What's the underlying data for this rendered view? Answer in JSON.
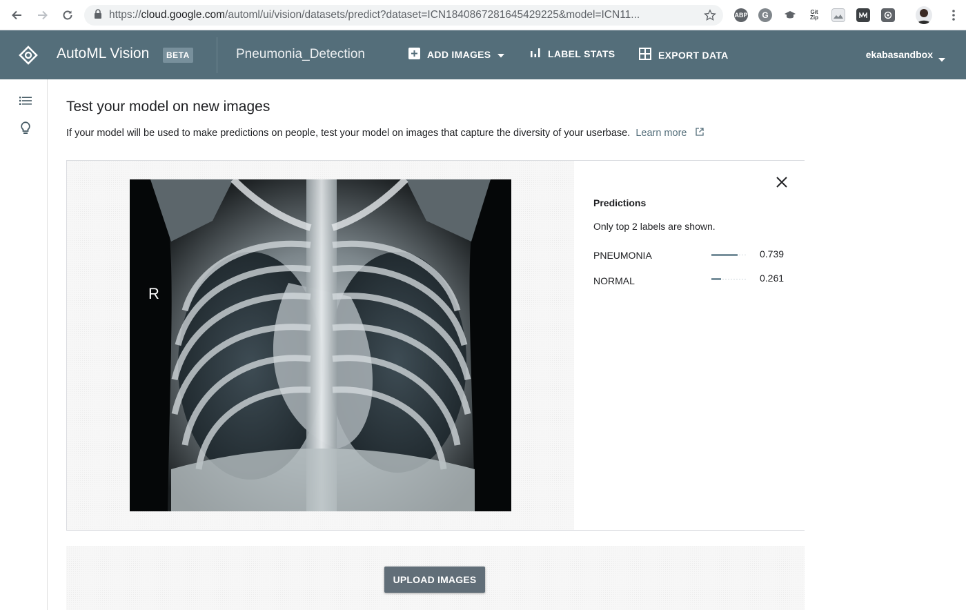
{
  "browser": {
    "url_scheme": "https://",
    "url_host": "cloud.google.com",
    "url_path": "/automl/ui/vision/datasets/predict?dataset=ICN1840867281645429225&model=ICN11...",
    "extensions": [
      "ABP",
      "G",
      "Git Zip"
    ]
  },
  "header": {
    "app_title": "AutoML Vision",
    "beta_label": "BETA",
    "dataset_name": "Pneumonia_Detection",
    "add_images_label": "ADD IMAGES",
    "label_stats_label": "LABEL STATS",
    "export_data_label": "EXPORT DATA",
    "account_name": "ekabasandbox"
  },
  "main": {
    "title": "Test your model on new images",
    "description": "If your model will be used to make predictions on people, test your model on images that capture the diversity of your userbase.",
    "learn_more_label": "Learn more",
    "image_marker": "R",
    "upload_button_label": "UPLOAD IMAGES"
  },
  "predictions": {
    "title": "Predictions",
    "note": "Only top 2 labels are shown.",
    "items": [
      {
        "label": "PNEUMONIA",
        "score": "0.739",
        "value": 0.739
      },
      {
        "label": "NORMAL",
        "score": "0.261",
        "value": 0.261
      }
    ]
  },
  "colors": {
    "header_bg": "#546e7a",
    "beta_bg": "#78909c",
    "bar_fill": "#78909c",
    "upload_button_bg": "#616e78",
    "link": "#546e7a"
  },
  "icons": [
    "back-arrow-icon",
    "forward-arrow-icon",
    "reload-icon",
    "lock-icon",
    "star-icon",
    "automl-logo-icon",
    "add-box-icon",
    "bar-chart-icon",
    "grid-icon",
    "caret-down-icon",
    "list-icon",
    "lightbulb-icon",
    "close-icon",
    "external-link-icon",
    "profile-avatar-icon"
  ]
}
